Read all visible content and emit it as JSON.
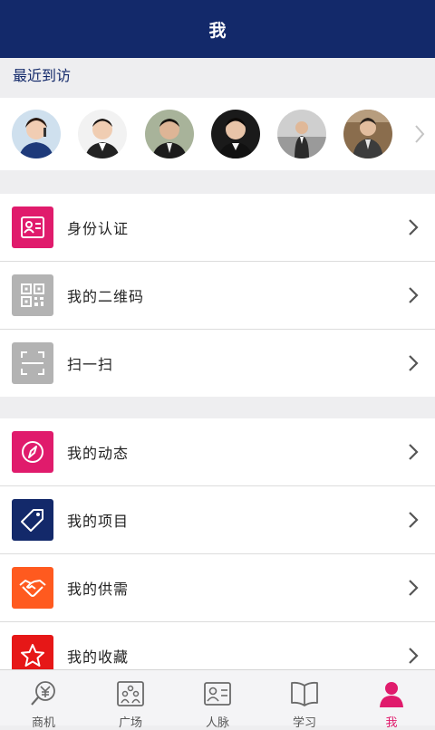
{
  "header": {
    "title": "我"
  },
  "recent": {
    "label": "最近到访",
    "visitors": [
      {
        "name": "visitor-1"
      },
      {
        "name": "visitor-2"
      },
      {
        "name": "visitor-3"
      },
      {
        "name": "visitor-4"
      },
      {
        "name": "visitor-5"
      },
      {
        "name": "visitor-6"
      }
    ]
  },
  "menu_group_1": [
    {
      "label": "身份认证",
      "icon": "id-card-icon",
      "color": "#e01b6c"
    },
    {
      "label": "我的二维码",
      "icon": "qr-code-icon",
      "color": "#b3b3b3"
    },
    {
      "label": "扫一扫",
      "icon": "scan-icon",
      "color": "#b3b3b3"
    }
  ],
  "menu_group_2": [
    {
      "label": "我的动态",
      "icon": "compass-icon",
      "color": "#e01b6c"
    },
    {
      "label": "我的项目",
      "icon": "tag-icon",
      "color": "#13296a"
    },
    {
      "label": "我的供需",
      "icon": "handshake-icon",
      "color": "#ff5a1f"
    },
    {
      "label": "我的收藏",
      "icon": "star-icon",
      "color": "#e61717"
    }
  ],
  "tabbar": {
    "tabs": [
      {
        "label": "商机",
        "icon": "business-icon",
        "active": false
      },
      {
        "label": "广场",
        "icon": "plaza-icon",
        "active": false
      },
      {
        "label": "人脉",
        "icon": "contacts-icon",
        "active": false
      },
      {
        "label": "学习",
        "icon": "book-icon",
        "active": false
      },
      {
        "label": "我",
        "icon": "person-icon",
        "active": true
      }
    ]
  },
  "colors": {
    "brand_navy": "#13296a",
    "accent_pink": "#e01b6c"
  }
}
